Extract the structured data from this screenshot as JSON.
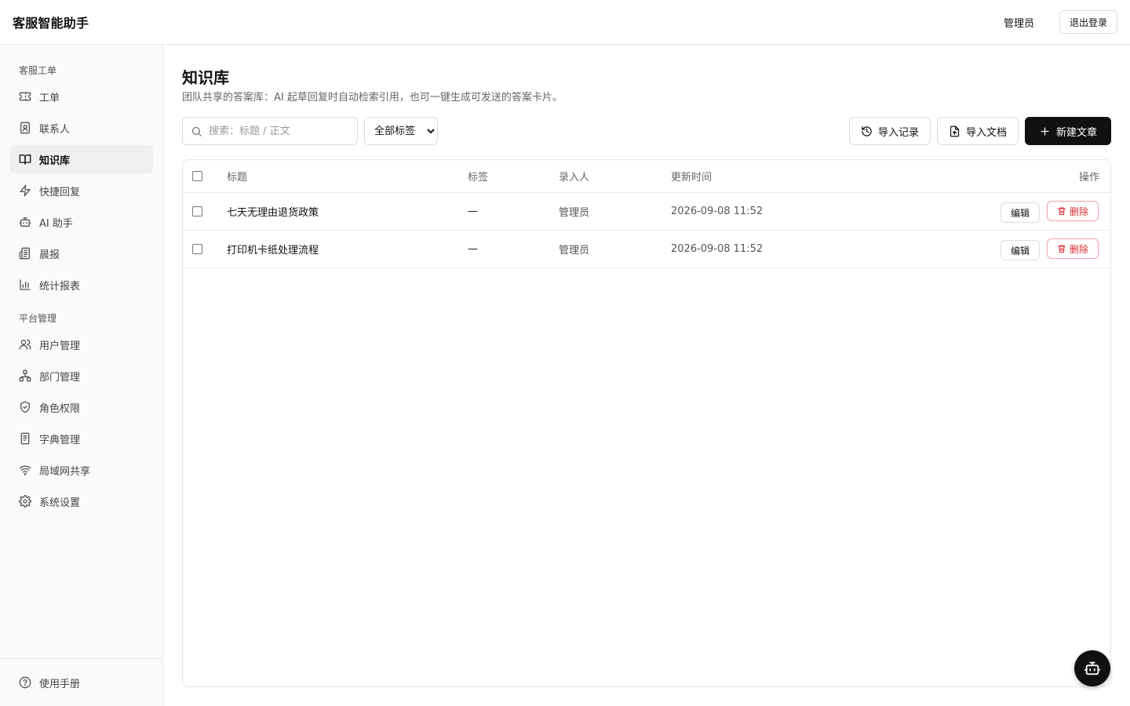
{
  "app": {
    "title": "客服智能助手"
  },
  "header": {
    "user_label": "管理员",
    "logout_label": "退出登录"
  },
  "sidebar": {
    "groups": [
      {
        "title": "客服工单",
        "items": [
          {
            "label": "工单",
            "icon": "ticket-icon"
          },
          {
            "label": "联系人",
            "icon": "contact-icon"
          },
          {
            "label": "知识库",
            "icon": "book-icon",
            "active": true
          },
          {
            "label": "快捷回复",
            "icon": "lightning-icon"
          },
          {
            "label": "AI 助手",
            "icon": "bot-icon"
          },
          {
            "label": "晨报",
            "icon": "newspaper-icon"
          },
          {
            "label": "统计报表",
            "icon": "bar-chart-icon"
          }
        ]
      },
      {
        "title": "平台管理",
        "items": [
          {
            "label": "用户管理",
            "icon": "users-icon"
          },
          {
            "label": "部门管理",
            "icon": "org-chart-icon"
          },
          {
            "label": "角色权限",
            "icon": "shield-icon"
          },
          {
            "label": "字典管理",
            "icon": "notebook-icon"
          },
          {
            "label": "局域网共享",
            "icon": "wifi-icon"
          },
          {
            "label": "系统设置",
            "icon": "gear-icon"
          }
        ]
      }
    ],
    "footer": {
      "label": "使用手册",
      "icon": "help-circle-icon"
    }
  },
  "page": {
    "title": "知识库",
    "subtitle": "团队共享的答案库：AI 起草回复时自动检索引用，也可一键生成可发送的答案卡片。"
  },
  "toolbar": {
    "search_placeholder": "搜索：标题 / 正文",
    "tag_filter": {
      "selected": "全部标签",
      "options": [
        "全部标签"
      ]
    },
    "import_history_label": "导入记录",
    "import_doc_label": "导入文档",
    "new_article_label": "新建文章"
  },
  "table": {
    "columns": {
      "title": "标题",
      "tags": "标签",
      "author": "录入人",
      "updated": "更新时间",
      "actions": "操作"
    },
    "rows": [
      {
        "title": "七天无理由退货政策",
        "tags": "—",
        "author": "管理员",
        "updated": "2026-09-08 11:52"
      },
      {
        "title": "打印机卡纸处理流程",
        "tags": "—",
        "author": "管理员",
        "updated": "2026-09-08 11:52"
      }
    ],
    "edit_label": "编辑",
    "delete_label": "删除"
  },
  "colors": {
    "primary": "#111111",
    "danger": "#d92c36",
    "border": "#e6e6e6",
    "sidebar_bg": "#fafafa"
  }
}
